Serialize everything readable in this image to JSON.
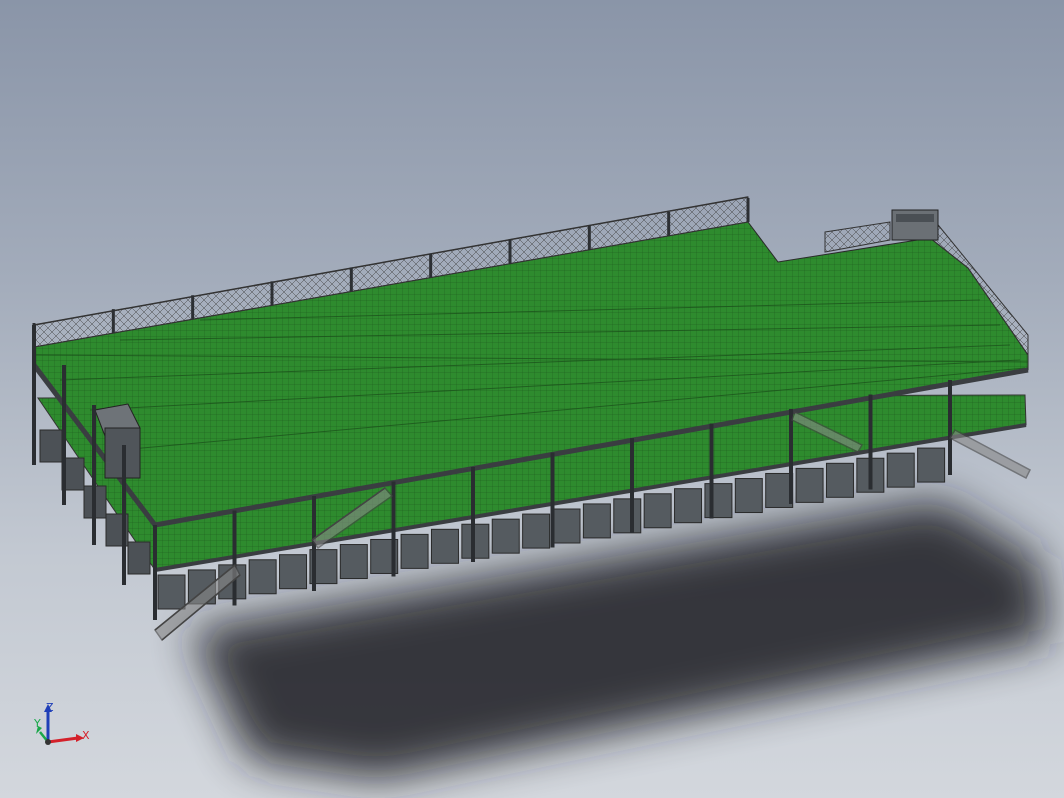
{
  "viewport": {
    "background_top": "#8a95a8",
    "background_bottom": "#d3d7dd"
  },
  "model": {
    "deck_color": "#2e8b2e",
    "deck_dark_color": "#1f6b1f",
    "frame_color": "#3a3d41",
    "box_color": "#555b60"
  },
  "triad": {
    "x_label": "X",
    "y_label": "Y",
    "z_label": "Z",
    "x_color": "#d4202a",
    "y_color": "#1aa84a",
    "z_color": "#1f3fb8"
  }
}
